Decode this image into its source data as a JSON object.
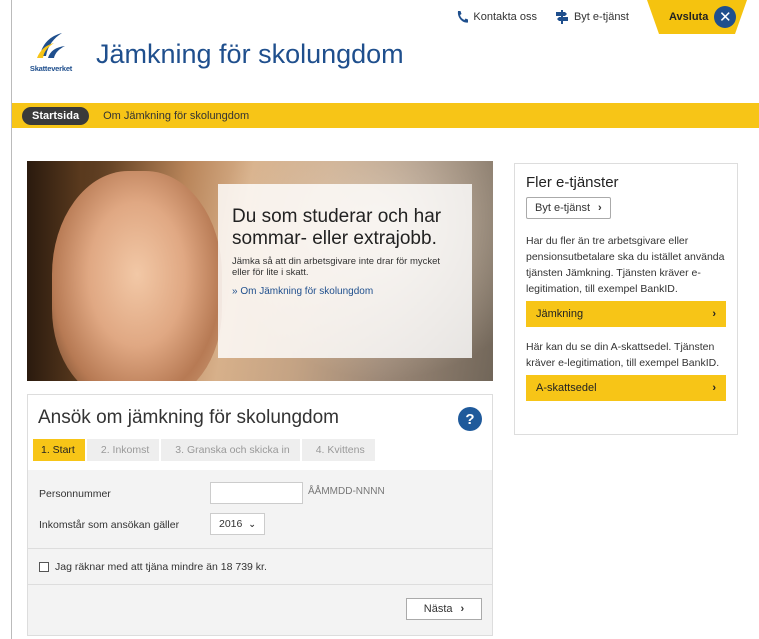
{
  "util": {
    "contact_label": "Kontakta oss",
    "switch_label": "Byt e-tjänst",
    "exit_label": "Avsluta"
  },
  "header": {
    "logo_text": "Skatteverket",
    "title": "Jämkning för skolungdom"
  },
  "nav": {
    "start_label": "Startsida",
    "about_label": "Om Jämkning för skolungdom"
  },
  "hero": {
    "heading": "Du som studerar och har sommar- eller extrajobb.",
    "text": "Jämka så att din arbetsgivare inte drar för mycket eller för lite i skatt.",
    "link": "» Om Jämkning för skolungdom"
  },
  "side": {
    "title": "Fler e-tjänster",
    "switch_button": "Byt e-tjänst",
    "jamkning_text": "Har du fler än tre arbetsgivare eller pensionsutbetalare ska du istället använda tjänsten Jämkning. Tjänsten kräver e-legitimation, till exempel BankID.",
    "jamkning_link": "Jämkning",
    "askatt_text": "Här kan du se din A-skattsedel. Tjänsten kräver e-legitimation, till exempel BankID.",
    "askatt_link": "A-skattsedel"
  },
  "form": {
    "title": "Ansök om jämkning för skolungdom",
    "help": "?",
    "steps": [
      "1. Start",
      "2. Inkomst",
      "3. Granska och skicka in",
      "4. Kvittens"
    ],
    "active_step": 0,
    "personnummer_label": "Personnummer",
    "personnummer_value": "",
    "personnummer_hint": "ÅÅMMDD-NNNN",
    "year_label": "Inkomstår som ansökan gäller",
    "year_value": "2016",
    "checkbox_label": "Jag räknar med att tjäna mindre än 18 739 kr.",
    "checkbox_checked": false,
    "next_label": "Nästa"
  },
  "colors": {
    "brand_yellow": "#f7c517",
    "brand_blue": "#1f4f8d"
  }
}
